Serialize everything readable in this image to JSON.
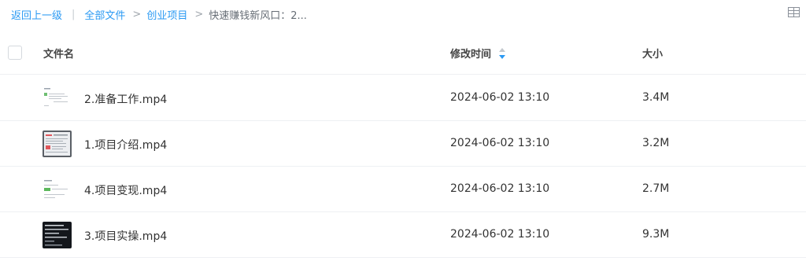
{
  "breadcrumb": {
    "back": "返回上一级",
    "separator_bar": "|",
    "separator_gt": ">",
    "items": [
      "全部文件",
      "创业项目"
    ],
    "current": "快速赚钱新风口：2..."
  },
  "table": {
    "headers": {
      "name": "文件名",
      "time": "修改时间",
      "size": "大小"
    },
    "rows": [
      {
        "name": "2.准备工作.mp4",
        "time": "2024-06-02 13:10",
        "size": "3.4M",
        "thumb": "light-slide"
      },
      {
        "name": "1.项目介绍.mp4",
        "time": "2024-06-02 13:10",
        "size": "3.2M",
        "thumb": "gray-screen"
      },
      {
        "name": "4.项目变现.mp4",
        "time": "2024-06-02 13:10",
        "size": "2.7M",
        "thumb": "light-slide-green"
      },
      {
        "name": "3.项目实操.mp4",
        "time": "2024-06-02 13:10",
        "size": "9.3M",
        "thumb": "dark-screen"
      }
    ]
  },
  "colors": {
    "link": "#2b9af3",
    "sort_active": "#2b9af3",
    "border": "#eef0f3"
  },
  "icons": {
    "view_toggle": "grid-list-icon",
    "sort": "sort-arrows-icon"
  }
}
